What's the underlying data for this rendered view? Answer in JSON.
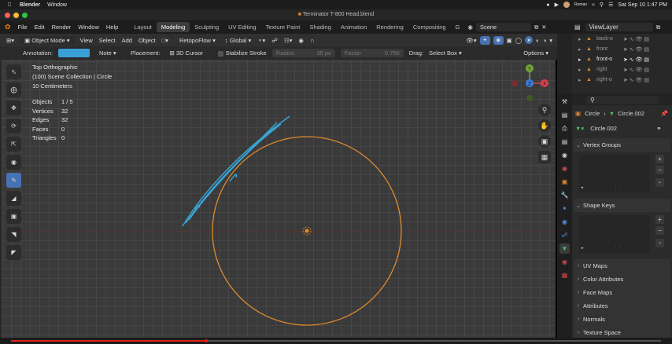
{
  "mac_menubar": {
    "app": "Blender",
    "menu": "Window",
    "user": "Roman",
    "datetime": "Sat Sep 10  1:47 PM"
  },
  "window": {
    "title": "Terminator T-800 Head.blend"
  },
  "topbar": {
    "menus": [
      "File",
      "Edit",
      "Render",
      "Window",
      "Help"
    ],
    "workspaces": [
      "Layout",
      "Modeling",
      "Sculpting",
      "UV Editing",
      "Texture Paint",
      "Shading",
      "Animation",
      "Rendering",
      "Compositing",
      "G"
    ],
    "active_workspace": "Modeling",
    "scene": "Scene",
    "view_layer": "ViewLayer"
  },
  "header": {
    "mode": "Object Mode",
    "menus": [
      "View",
      "Select",
      "Add",
      "Object"
    ],
    "addon": "RetopoFlow",
    "orientation": "Global"
  },
  "tool_settings": {
    "annotation_label": "Annotation:",
    "annotation_color": "#3a9fd6",
    "note": "Note",
    "placement_label": "Placement:",
    "placement": "3D Cursor",
    "stabilize": "Stabilize Stroke",
    "radius_label": "Radius",
    "radius_value": "35 px",
    "factor_label": "Factor",
    "factor_value": "0.750",
    "drag_label": "Drag:",
    "drag": "Select Box",
    "options": "Options"
  },
  "viewport": {
    "view_name": "Top Orthographic",
    "collection": "(100) Scene Collection | Circle",
    "scale": "10 Centimeters",
    "stats": [
      {
        "label": "Objects",
        "value": "1 / 5"
      },
      {
        "label": "Vertices",
        "value": "32"
      },
      {
        "label": "Edges",
        "value": "32"
      },
      {
        "label": "Faces",
        "value": "0"
      },
      {
        "label": "Triangles",
        "value": "0"
      }
    ],
    "gizmo": {
      "x": "X",
      "y": "Y",
      "z": "Z"
    },
    "circle_color": "#e08a2e",
    "stroke_color": "#3aa6d8"
  },
  "outliner": {
    "items": [
      "back-o",
      "front",
      "front-o",
      "right",
      "right-o"
    ]
  },
  "properties": {
    "breadcrumb_object": "Circle",
    "breadcrumb_mesh": "Circle.002",
    "mesh_name": "Circle.002",
    "panels_open": [
      "Vertex Groups",
      "Shape Keys"
    ],
    "panels_closed": [
      "UV Maps",
      "Color Attributes",
      "Face Maps",
      "Attributes",
      "Normals",
      "Texture Space"
    ]
  },
  "progress": {
    "played_fraction": 0.3
  }
}
